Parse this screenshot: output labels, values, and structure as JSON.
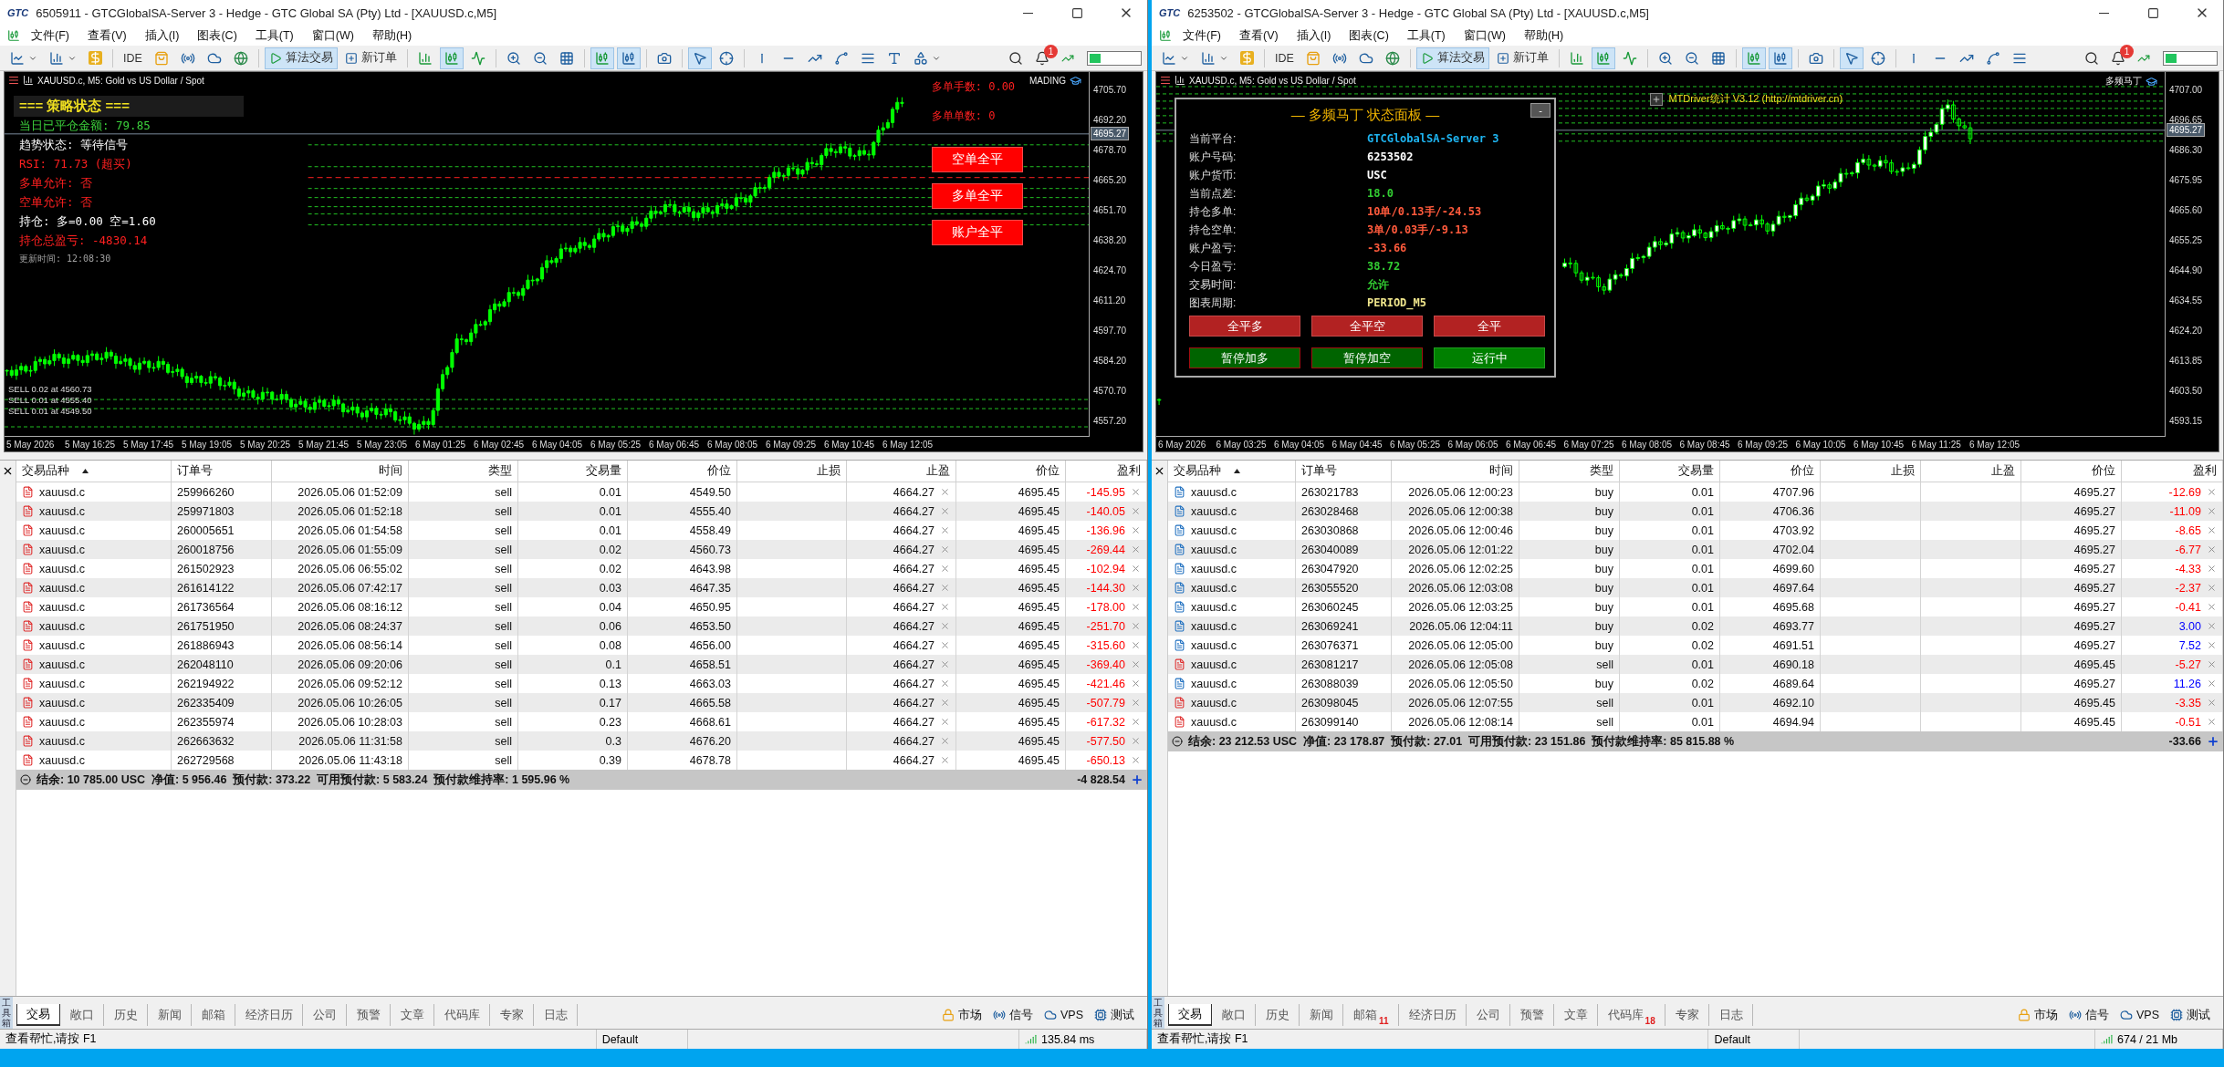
{
  "windows": [
    {
      "logo": "GTC",
      "title": "6505911 - GTCGlobalSA-Server 3 - Hedge - GTC Global SA (Pty) Ltd - [XAUUSD.c,M5]",
      "menu": [
        "文件(F)",
        "查看(V)",
        "插入(I)",
        "图表(C)",
        "工具(T)",
        "窗口(W)",
        "帮助(H)"
      ],
      "toolbar": {
        "ide": "IDE",
        "algo": "算法交易",
        "new_order": "新订单",
        "notifications": "1"
      },
      "chart": {
        "caption": "XAUUSD.c, M5:  Gold vs US Dollar / Spot",
        "corner_label": "MADING",
        "current_price": "4695.27",
        "price_ticks": [
          "4705.70",
          "4692.20",
          "4678.70",
          "4665.20",
          "4651.70",
          "4638.20",
          "4624.70",
          "4611.20",
          "4597.70",
          "4584.20",
          "4570.70",
          "4557.20"
        ],
        "time_ticks": [
          "5 May 2026",
          "5 May 16:25",
          "5 May 17:45",
          "5 May 19:05",
          "5 May 20:25",
          "5 May 21:45",
          "5 May 23:05",
          "6 May 01:25",
          "6 May 02:45",
          "6 May 04:05",
          "6 May 05:25",
          "6 May 06:45",
          "6 May 08:05",
          "6 May 09:25",
          "6 May 10:45",
          "6 May 12:05"
        ],
        "strategy_panel": {
          "title": "=== 策略状态 ===",
          "lines": [
            {
              "text": "当日已平仓金额: 79.85",
              "color": "#3cd23c"
            },
            {
              "text": "趋势状态: 等待信号",
              "color": "#ffffff"
            },
            {
              "text": "RSI: 71.73 (超买)",
              "color": "#ff2020"
            },
            {
              "text": "多单允许: 否",
              "color": "#ff2020"
            },
            {
              "text": "空单允许: 否",
              "color": "#ff2020"
            },
            {
              "text": "持仓: 多=0.00 空=1.60",
              "color": "#ffffff"
            },
            {
              "text": "持仓总盈亏: -4830.14",
              "color": "#ff2020"
            },
            {
              "text": "更新时间: 12:08:30",
              "color": "#a0a0a0"
            }
          ]
        },
        "side_labels": [
          "多单手数: 0.00",
          "多单单数: 0"
        ],
        "buttons": [
          "空单全平",
          "多单全平",
          "账户全平"
        ],
        "order_labels": [
          "SELL 0.02 at 4560.73",
          "SELL 0.01 at 4555.40",
          "SELL 0.01 at 4549.50"
        ]
      },
      "table": {
        "columns": [
          "交易品种",
          "订单号",
          "时间",
          "类型",
          "交易量",
          "价位",
          "止损",
          "止盈",
          "价位",
          "盈利"
        ],
        "rows": [
          {
            "symbol": "xauusd.c",
            "order": "259966260",
            "time": "2026.05.06 01:52:09",
            "type": "sell",
            "volume": "0.01",
            "price": "4549.50",
            "tp": "4664.27",
            "market": "4695.45",
            "profit": "-145.95",
            "kind": "sell",
            "color": "#ff0000"
          },
          {
            "symbol": "xauusd.c",
            "order": "259971803",
            "time": "2026.05.06 01:52:18",
            "type": "sell",
            "volume": "0.01",
            "price": "4555.40",
            "tp": "4664.27",
            "market": "4695.45",
            "profit": "-140.05",
            "kind": "sell",
            "color": "#ff0000"
          },
          {
            "symbol": "xauusd.c",
            "order": "260005651",
            "time": "2026.05.06 01:54:58",
            "type": "sell",
            "volume": "0.01",
            "price": "4558.49",
            "tp": "4664.27",
            "market": "4695.45",
            "profit": "-136.96",
            "kind": "sell",
            "color": "#ff0000"
          },
          {
            "symbol": "xauusd.c",
            "order": "260018756",
            "time": "2026.05.06 01:55:09",
            "type": "sell",
            "volume": "0.02",
            "price": "4560.73",
            "tp": "4664.27",
            "market": "4695.45",
            "profit": "-269.44",
            "kind": "sell",
            "color": "#ff0000"
          },
          {
            "symbol": "xauusd.c",
            "order": "261502923",
            "time": "2026.05.06 06:55:02",
            "type": "sell",
            "volume": "0.02",
            "price": "4643.98",
            "tp": "4664.27",
            "market": "4695.45",
            "profit": "-102.94",
            "kind": "sell",
            "color": "#ff0000"
          },
          {
            "symbol": "xauusd.c",
            "order": "261614122",
            "time": "2026.05.06 07:42:17",
            "type": "sell",
            "volume": "0.03",
            "price": "4647.35",
            "tp": "4664.27",
            "market": "4695.45",
            "profit": "-144.30",
            "kind": "sell",
            "color": "#ff0000"
          },
          {
            "symbol": "xauusd.c",
            "order": "261736564",
            "time": "2026.05.06 08:16:12",
            "type": "sell",
            "volume": "0.04",
            "price": "4650.95",
            "tp": "4664.27",
            "market": "4695.45",
            "profit": "-178.00",
            "kind": "sell",
            "color": "#ff0000"
          },
          {
            "symbol": "xauusd.c",
            "order": "261751950",
            "time": "2026.05.06 08:24:37",
            "type": "sell",
            "volume": "0.06",
            "price": "4653.50",
            "tp": "4664.27",
            "market": "4695.45",
            "profit": "-251.70",
            "kind": "sell",
            "color": "#ff0000"
          },
          {
            "symbol": "xauusd.c",
            "order": "261886943",
            "time": "2026.05.06 08:56:14",
            "type": "sell",
            "volume": "0.08",
            "price": "4656.00",
            "tp": "4664.27",
            "market": "4695.45",
            "profit": "-315.60",
            "kind": "sell",
            "color": "#ff0000"
          },
          {
            "symbol": "xauusd.c",
            "order": "262048110",
            "time": "2026.05.06 09:20:06",
            "type": "sell",
            "volume": "0.1",
            "price": "4658.51",
            "tp": "4664.27",
            "market": "4695.45",
            "profit": "-369.40",
            "kind": "sell",
            "color": "#ff0000"
          },
          {
            "symbol": "xauusd.c",
            "order": "262194922",
            "time": "2026.05.06 09:52:12",
            "type": "sell",
            "volume": "0.13",
            "price": "4663.03",
            "tp": "4664.27",
            "market": "4695.45",
            "profit": "-421.46",
            "kind": "sell",
            "color": "#ff0000"
          },
          {
            "symbol": "xauusd.c",
            "order": "262335409",
            "time": "2026.05.06 10:26:05",
            "type": "sell",
            "volume": "0.17",
            "price": "4665.58",
            "tp": "4664.27",
            "market": "4695.45",
            "profit": "-507.79",
            "kind": "sell",
            "color": "#ff0000"
          },
          {
            "symbol": "xauusd.c",
            "order": "262355974",
            "time": "2026.05.06 10:28:03",
            "type": "sell",
            "volume": "0.23",
            "price": "4668.61",
            "tp": "4664.27",
            "market": "4695.45",
            "profit": "-617.32",
            "kind": "sell",
            "color": "#ff0000"
          },
          {
            "symbol": "xauusd.c",
            "order": "262663632",
            "time": "2026.05.06 11:31:58",
            "type": "sell",
            "volume": "0.3",
            "price": "4676.20",
            "tp": "4664.27",
            "market": "4695.45",
            "profit": "-577.50",
            "kind": "sell",
            "color": "#ff0000"
          },
          {
            "symbol": "xauusd.c",
            "order": "262729568",
            "time": "2026.05.06 11:43:18",
            "type": "sell",
            "volume": "0.39",
            "price": "4678.78",
            "tp": "4664.27",
            "market": "4695.45",
            "profit": "-650.13",
            "kind": "sell",
            "color": "#ff0000"
          }
        ],
        "summary": "结余: 10 785.00 USC  净值: 5 956.46  预付款: 373.22  可用预付款: 5 583.24  预付款维持率: 1 595.96 %",
        "total": "-4 828.54"
      },
      "toolbox_label": "工具箱",
      "tabs": [
        {
          "label": "交易",
          "selected": true
        },
        {
          "label": "敞口",
          "selected": false
        },
        {
          "label": "历史",
          "selected": false
        },
        {
          "label": "新闻",
          "selected": false
        },
        {
          "label": "邮箱",
          "selected": false
        },
        {
          "label": "经济日历",
          "selected": false
        },
        {
          "label": "公司",
          "selected": false
        },
        {
          "label": "预警",
          "selected": false
        },
        {
          "label": "文章",
          "selected": false
        },
        {
          "label": "代码库",
          "selected": false
        },
        {
          "label": "专家",
          "selected": false
        },
        {
          "label": "日志",
          "selected": false
        }
      ],
      "links": [
        "市场",
        "信号",
        "VPS",
        "测试"
      ],
      "status": {
        "help": "查看帮忙,请按 F1",
        "profile": "Default",
        "connection": "135.84 ms"
      }
    },
    {
      "logo": "GTC",
      "title": "6253502 - GTCGlobalSA-Server 3 - Hedge - GTC Global SA (Pty) Ltd - [XAUUSD.c,M5]",
      "menu": [
        "文件(F)",
        "查看(V)",
        "插入(I)",
        "图表(C)",
        "工具(T)",
        "窗口(W)",
        "帮助(H)"
      ],
      "toolbar": {
        "ide": "IDE",
        "algo": "算法交易",
        "new_order": "新订单",
        "notifications": "1"
      },
      "chart": {
        "caption": "XAUUSD.c, M5:  Gold vs US Dollar / Spot",
        "corner_label": "多频马丁",
        "current_price": "4695.27",
        "price_ticks": [
          "4707.00",
          "4696.65",
          "4686.30",
          "4675.95",
          "4665.60",
          "4655.25",
          "4644.90",
          "4634.55",
          "4624.20",
          "4613.85",
          "4603.50",
          "4593.15"
        ],
        "time_ticks": [
          "6 May 2026",
          "6 May 03:25",
          "6 May 04:05",
          "6 May 04:45",
          "6 May 05:25",
          "6 May 06:05",
          "6 May 06:45",
          "6 May 07:25",
          "6 May 08:05",
          "6 May 08:45",
          "6 May 09:25",
          "6 May 10:05",
          "6 May 10:45",
          "6 May 11:25",
          "6 May 12:05"
        ],
        "banner": "MTDriver统计  V3.12 (http://mtdriver.cn)",
        "info_panel": {
          "title": "— 多频马丁 状态面板 —",
          "close": "-",
          "rows": [
            {
              "label": "当前平台:",
              "value": "GTCGlobalSA-Server 3",
              "color": "#1eb4f0"
            },
            {
              "label": "账户号码:",
              "value": "6253502",
              "color": "#ffffff"
            },
            {
              "label": "账户货币:",
              "value": "USC",
              "color": "#ffffff"
            },
            {
              "label": "当前点差:",
              "value": "18.0",
              "color": "#32cd32"
            },
            {
              "label": "持仓多单:",
              "value": "10单/0.13手/-24.53",
              "color": "#ff5a3c"
            },
            {
              "label": "持仓空单:",
              "value": "3单/0.03手/-9.13",
              "color": "#ff5a3c"
            },
            {
              "label": "账户盈亏:",
              "value": "-33.66",
              "color": "#ff5a3c"
            },
            {
              "label": "今日盈亏:",
              "value": "38.72",
              "color": "#32cd32"
            },
            {
              "label": "交易时间:",
              "value": "允许",
              "color": "#32cd32"
            },
            {
              "label": "图表周期:",
              "value": "PERIOD_M5",
              "color": "#f0e68c"
            }
          ],
          "buttons": [
            {
              "label": "全平多",
              "kind": "close"
            },
            {
              "label": "全平空",
              "kind": "close"
            },
            {
              "label": "全平",
              "kind": "close"
            },
            {
              "label": "暂停加多",
              "kind": "pause"
            },
            {
              "label": "暂停加空",
              "kind": "pause"
            },
            {
              "label": "运行中",
              "kind": "running"
            }
          ]
        }
      },
      "table": {
        "columns": [
          "交易品种",
          "订单号",
          "时间",
          "类型",
          "交易量",
          "价位",
          "止损",
          "止盈",
          "价位",
          "盈利"
        ],
        "rows": [
          {
            "symbol": "xauusd.c",
            "order": "263021783",
            "time": "2026.05.06 12:00:23",
            "type": "buy",
            "volume": "0.01",
            "price": "4707.96",
            "market": "4695.27",
            "profit": "-12.69",
            "kind": "buy",
            "color": "#ff0000"
          },
          {
            "symbol": "xauusd.c",
            "order": "263028468",
            "time": "2026.05.06 12:00:38",
            "type": "buy",
            "volume": "0.01",
            "price": "4706.36",
            "market": "4695.27",
            "profit": "-11.09",
            "kind": "buy",
            "color": "#ff0000"
          },
          {
            "symbol": "xauusd.c",
            "order": "263030868",
            "time": "2026.05.06 12:00:46",
            "type": "buy",
            "volume": "0.01",
            "price": "4703.92",
            "market": "4695.27",
            "profit": "-8.65",
            "kind": "buy",
            "color": "#ff0000"
          },
          {
            "symbol": "xauusd.c",
            "order": "263040089",
            "time": "2026.05.06 12:01:22",
            "type": "buy",
            "volume": "0.01",
            "price": "4702.04",
            "market": "4695.27",
            "profit": "-6.77",
            "kind": "buy",
            "color": "#ff0000"
          },
          {
            "symbol": "xauusd.c",
            "order": "263047920",
            "time": "2026.05.06 12:02:25",
            "type": "buy",
            "volume": "0.01",
            "price": "4699.60",
            "market": "4695.27",
            "profit": "-4.33",
            "kind": "buy",
            "color": "#ff0000"
          },
          {
            "symbol": "xauusd.c",
            "order": "263055520",
            "time": "2026.05.06 12:03:08",
            "type": "buy",
            "volume": "0.01",
            "price": "4697.64",
            "market": "4695.27",
            "profit": "-2.37",
            "kind": "buy",
            "color": "#ff0000"
          },
          {
            "symbol": "xauusd.c",
            "order": "263060245",
            "time": "2026.05.06 12:03:25",
            "type": "buy",
            "volume": "0.01",
            "price": "4695.68",
            "market": "4695.27",
            "profit": "-0.41",
            "kind": "buy",
            "color": "#ff0000"
          },
          {
            "symbol": "xauusd.c",
            "order": "263069241",
            "time": "2026.05.06 12:04:11",
            "type": "buy",
            "volume": "0.02",
            "price": "4693.77",
            "market": "4695.27",
            "profit": "3.00",
            "kind": "buy",
            "color": "#0000ff"
          },
          {
            "symbol": "xauusd.c",
            "order": "263076371",
            "time": "2026.05.06 12:05:00",
            "type": "buy",
            "volume": "0.02",
            "price": "4691.51",
            "market": "4695.27",
            "profit": "7.52",
            "kind": "buy",
            "color": "#0000ff"
          },
          {
            "symbol": "xauusd.c",
            "order": "263081217",
            "time": "2026.05.06 12:05:08",
            "type": "sell",
            "volume": "0.01",
            "price": "4690.18",
            "market": "4695.45",
            "profit": "-5.27",
            "kind": "sell",
            "color": "#ff0000"
          },
          {
            "symbol": "xauusd.c",
            "order": "263088039",
            "time": "2026.05.06 12:05:50",
            "type": "buy",
            "volume": "0.02",
            "price": "4689.64",
            "market": "4695.27",
            "profit": "11.26",
            "kind": "buy",
            "color": "#0000ff"
          },
          {
            "symbol": "xauusd.c",
            "order": "263098045",
            "time": "2026.05.06 12:07:55",
            "type": "sell",
            "volume": "0.01",
            "price": "4692.10",
            "market": "4695.45",
            "profit": "-3.35",
            "kind": "sell",
            "color": "#ff0000"
          },
          {
            "symbol": "xauusd.c",
            "order": "263099140",
            "time": "2026.05.06 12:08:14",
            "type": "sell",
            "volume": "0.01",
            "price": "4694.94",
            "market": "4695.45",
            "profit": "-0.51",
            "kind": "sell",
            "color": "#ff0000"
          }
        ],
        "summary": "结余: 23 212.53 USC  净值: 23 178.87  预付款: 27.01  可用预付款: 23 151.86  预付款维持率: 85 815.88 %",
        "total": "-33.66"
      },
      "toolbox_label": "工具箱",
      "tabs": [
        {
          "label": "交易",
          "selected": true
        },
        {
          "label": "敞口",
          "selected": false
        },
        {
          "label": "历史",
          "selected": false
        },
        {
          "label": "新闻",
          "selected": false
        },
        {
          "label": "邮箱",
          "selected": false,
          "badge": "11"
        },
        {
          "label": "经济日历",
          "selected": false
        },
        {
          "label": "公司",
          "selected": false
        },
        {
          "label": "预警",
          "selected": false
        },
        {
          "label": "文章",
          "selected": false
        },
        {
          "label": "代码库",
          "selected": false,
          "badge": "18"
        },
        {
          "label": "专家",
          "selected": false
        },
        {
          "label": "日志",
          "selected": false
        }
      ],
      "links": [
        "市场",
        "信号",
        "VPS",
        "测试"
      ],
      "status": {
        "help": "查看帮忙,请按 F1",
        "profile": "Default",
        "connection": "674 / 21 Mb"
      }
    }
  ]
}
